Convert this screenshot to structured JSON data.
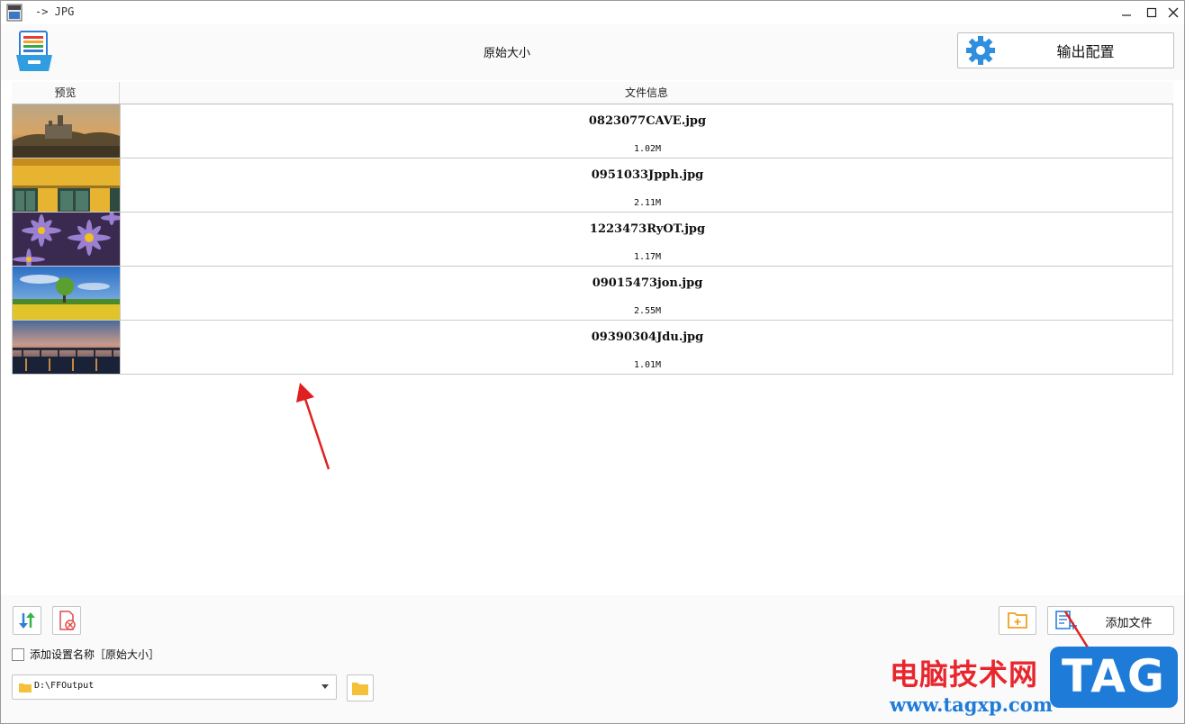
{
  "window": {
    "title": "-> JPG"
  },
  "header": {
    "mode_label": "原始大小",
    "config_button": "输出配置"
  },
  "table": {
    "columns": [
      "预览",
      "文件信息"
    ],
    "rows": [
      {
        "name": "0823077CAVE.jpg",
        "size": "1.02M",
        "thumb": "castle-sunset-thumbnail"
      },
      {
        "name": "0951033Jpph.jpg",
        "size": "2.11M",
        "thumb": "yellow-wall-windows-thumbnail"
      },
      {
        "name": "1223473RyOT.jpg",
        "size": "1.17M",
        "thumb": "purple-daisies-thumbnail"
      },
      {
        "name": "09015473jon.jpg",
        "size": "2.55M",
        "thumb": "tree-field-thumbnail"
      },
      {
        "name": "09390304Jdu.jpg",
        "size": "1.01M",
        "thumb": "bridge-dusk-thumbnail"
      }
    ]
  },
  "bottom": {
    "checkbox_label": "添加设置名称［原始大小］",
    "checkbox_checked": false,
    "output_path": "D:\\FFOutput",
    "add_file_button": "添加文件"
  },
  "watermark": {
    "cn": "电脑技术网",
    "url": "www.tagxp.com",
    "tag": "TAG"
  },
  "colors": {
    "accent_blue": "#1f7bd8",
    "annotation_red": "#e02020",
    "folder_yellow": "#f5c03a"
  }
}
